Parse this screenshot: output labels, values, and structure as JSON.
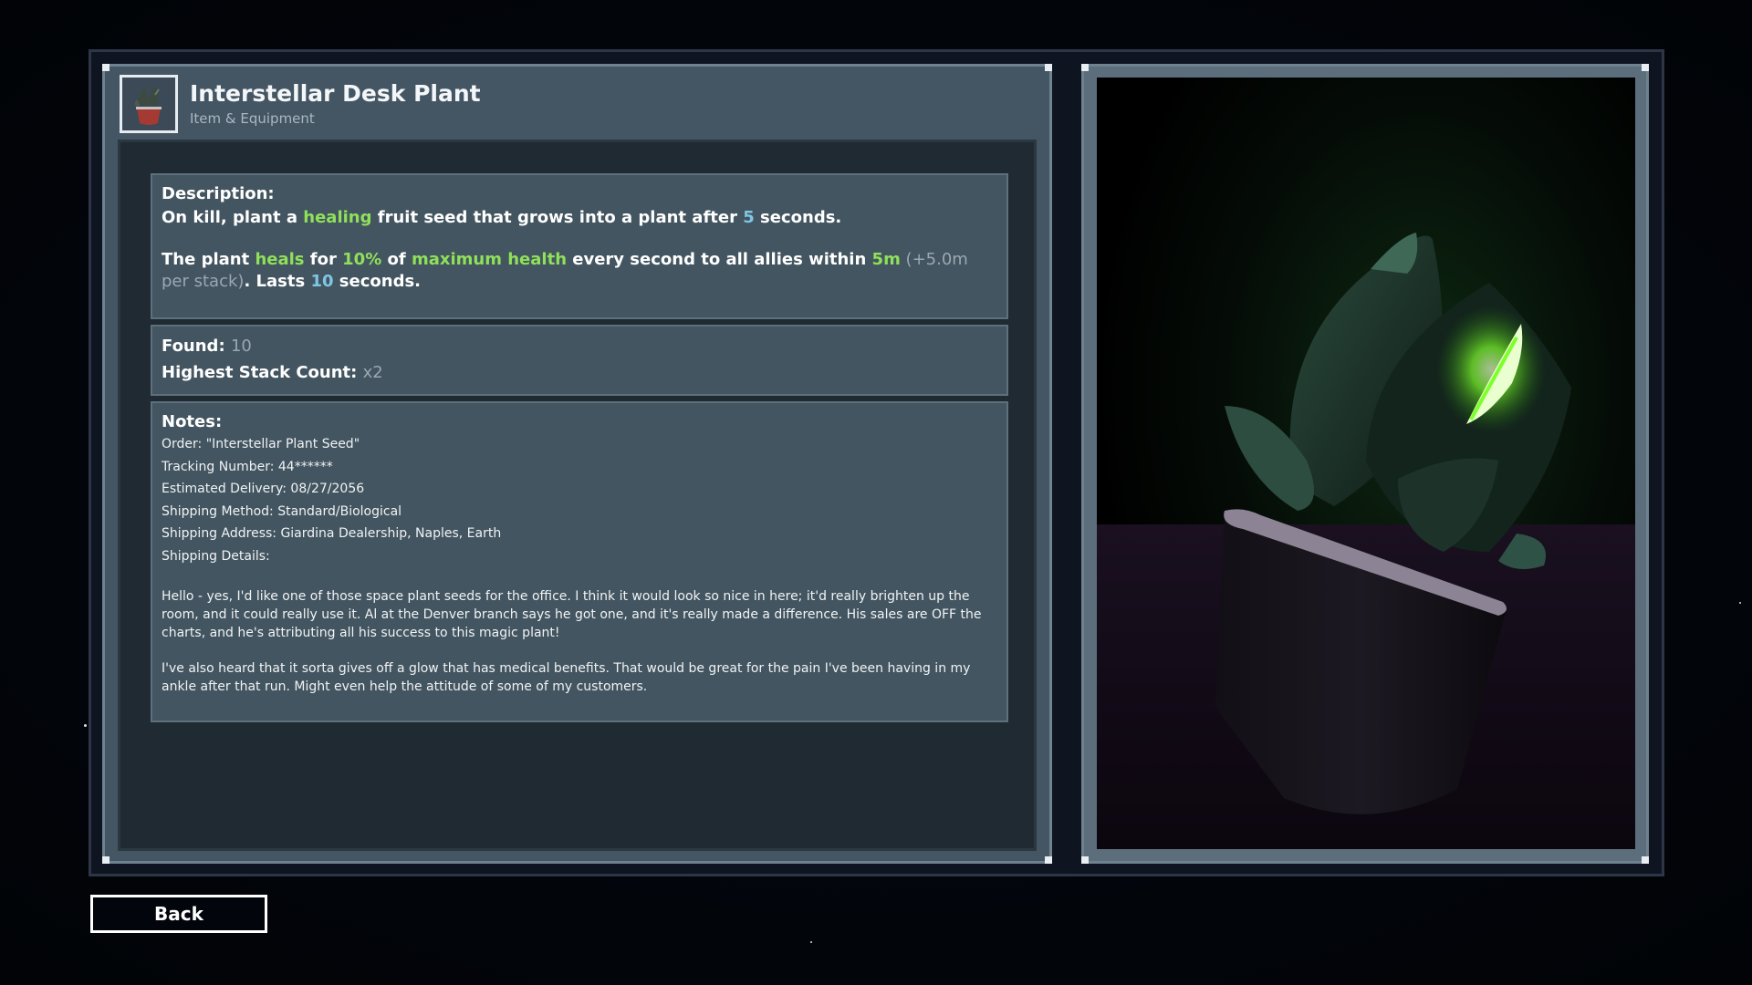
{
  "item": {
    "title": "Interstellar Desk Plant",
    "category": "Item & Equipment",
    "icon": "plant-pot-icon"
  },
  "description": {
    "label": "Description:",
    "line1": [
      {
        "t": "On kill, plant a ",
        "c": "white"
      },
      {
        "t": "healing",
        "c": "green"
      },
      {
        "t": " fruit seed that grows into a plant after ",
        "c": "white"
      },
      {
        "t": "5",
        "c": "blue"
      },
      {
        "t": " seconds.",
        "c": "white"
      }
    ],
    "line2": [
      {
        "t": "The plant ",
        "c": "white"
      },
      {
        "t": "heals",
        "c": "green"
      },
      {
        "t": " for ",
        "c": "white"
      },
      {
        "t": "10%",
        "c": "green"
      },
      {
        "t": " of ",
        "c": "white"
      },
      {
        "t": "maximum health",
        "c": "green"
      },
      {
        "t": " every second to all allies within ",
        "c": "white"
      },
      {
        "t": "5m",
        "c": "green"
      },
      {
        "t": " (+5.0m per stack)",
        "c": "grey"
      },
      {
        "t": ". Lasts ",
        "c": "white"
      },
      {
        "t": "10",
        "c": "blue"
      },
      {
        "t": " seconds.",
        "c": "white"
      }
    ]
  },
  "stats": {
    "found_label": "Found:",
    "found_value": "10",
    "stack_label": "Highest Stack Count:",
    "stack_value": "x2"
  },
  "notes": {
    "label": "Notes:",
    "lines": [
      "Order: \"Interstellar Plant Seed\"",
      "Tracking Number: 44******",
      "Estimated Delivery: 08/27/2056",
      "Shipping Method:  Standard/Biological",
      "Shipping Address: Giardina Dealership, Naples, Earth",
      "Shipping Details:"
    ],
    "paragraph1": "Hello - yes, I'd like one of those space plant seeds for the office. I think it would look so nice in here; it'd really brighten up the room, and it could really use it. Al at the Denver branch says he got one, and it's really made a difference. His sales are OFF the charts, and he's attributing all his success to this magic plant!",
    "paragraph2": "I've also heard that it sorta gives off a glow that has medical benefits. That would be great for the pain I've been having in my ankle after that run. Might even help the attitude of some of my customers."
  },
  "back_label": "Back",
  "colors": {
    "green": "#8fe05a",
    "blue": "#7fc6e6",
    "grey": "#9aa8b2",
    "glow": "#7dff2a"
  }
}
